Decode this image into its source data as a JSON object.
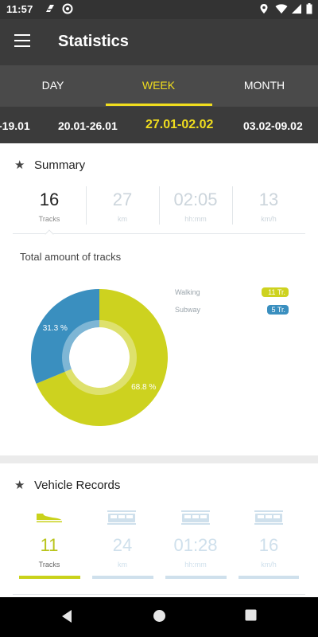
{
  "status_bar": {
    "time": "11:57",
    "icons": [
      "app-notification-icon",
      "sync-icon",
      "location-icon",
      "wifi-icon",
      "signal-icon",
      "battery-icon"
    ]
  },
  "app_bar": {
    "title": "Statistics",
    "menu_icon": "hamburger-menu-icon"
  },
  "tabs": [
    {
      "label": "DAY",
      "active": false
    },
    {
      "label": "WEEK",
      "active": true
    },
    {
      "label": "MONTH",
      "active": false
    }
  ],
  "date_ranges": [
    {
      "label": "-19.01",
      "active": false
    },
    {
      "label": "20.01-26.01",
      "active": false
    },
    {
      "label": "27.01-02.02",
      "active": true
    },
    {
      "label": "03.02-09.02",
      "active": false
    }
  ],
  "summary": {
    "header": "Summary",
    "stats": [
      {
        "value": "16",
        "label": "Tracks",
        "selected": true
      },
      {
        "value": "27",
        "label": "km",
        "selected": false
      },
      {
        "value": "02:05",
        "label": "hh:mm",
        "selected": false
      },
      {
        "value": "13",
        "label": "km/h",
        "selected": false
      }
    ]
  },
  "chart_data": {
    "type": "pie",
    "title": "Total amount of tracks",
    "slices": [
      {
        "name": "Walking",
        "badge": "11 Tr.",
        "value": 11,
        "percent_label": "68.8 %",
        "color": "#cdd21f"
      },
      {
        "name": "Subway",
        "badge": "5 Tr.",
        "value": 5,
        "percent_label": "31.3 %",
        "color": "#3a8fbf"
      }
    ],
    "legend_position": "right"
  },
  "vehicle_records": {
    "header": "Vehicle Records",
    "items": [
      {
        "value": "11",
        "label": "Tracks",
        "icon": "shoe-icon",
        "selected": true
      },
      {
        "value": "24",
        "label": "km",
        "icon": "subway-train-icon",
        "selected": false
      },
      {
        "value": "01:28",
        "label": "hh:mm",
        "icon": "subway-train-icon",
        "selected": false
      },
      {
        "value": "16",
        "label": "km/h",
        "icon": "subway-train-icon",
        "selected": false
      }
    ]
  },
  "colors": {
    "accent": "#f0dd1e",
    "walking": "#cdd21f",
    "subway": "#3a8fbf",
    "toolbar": "#3b3b3b"
  },
  "nav_bar": {
    "icons": [
      "back-icon",
      "home-icon",
      "recents-icon"
    ]
  }
}
